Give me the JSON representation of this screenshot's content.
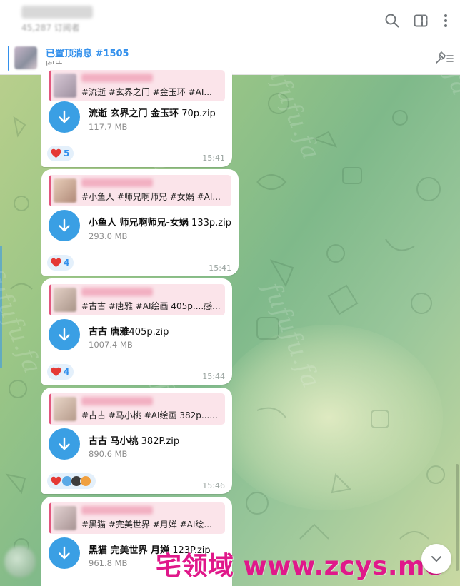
{
  "header": {
    "chat_title": "",
    "chat_subtitle": "45,287 订阅者",
    "icons": [
      "search-icon",
      "sidebar-toggle-icon",
      "more-vert-icon"
    ]
  },
  "pinned": {
    "title": "已置顶消息 #1505",
    "subtitle": "图片"
  },
  "messages": [
    {
      "reply_tags": "#流逝 #玄界之门 #金玉环 #AI...",
      "file_bold": "流逝 玄界之门 金玉环",
      "file_rest": " 70p.zip",
      "size": "117.7 MB",
      "reaction_count": "5",
      "time": "15:41"
    },
    {
      "reply_tags": "#小鱼人 #师兄啊师兄 #女娲 #AI...",
      "file_bold": "小鱼人 师兄啊师兄-女娲",
      "file_rest": " 133p.zip",
      "size": "293.0 MB",
      "reaction_count": "4",
      "time": "15:41"
    },
    {
      "reply_tags": "#古古 #唐雅 #AI绘画 405p....感...",
      "file_bold": "古古 唐雅",
      "file_rest": "405p.zip",
      "size": "1007.4 MB",
      "reaction_count": "4",
      "time": "15:44"
    },
    {
      "reply_tags": "#古古 #马小桃 #AI绘画 382p......",
      "file_bold": "古古 马小桃",
      "file_rest": " 382P.zip",
      "size": "890.6 MB",
      "reaction_count": "",
      "time": "15:46"
    },
    {
      "reply_tags": "#黑猫 #完美世界 #月婵 #AI绘...",
      "file_bold": "黑猫 完美世界 月婵",
      "file_rest": " 123P.zip",
      "size": "961.8 MB",
      "reaction_count": "",
      "time": ""
    }
  ],
  "watermarks": {
    "main": "宅领域 www.zcys.me",
    "diagonal": "fufufu.fa"
  },
  "colors": {
    "accent": "#3390ec",
    "download_button": "#3a9fe4",
    "reply_bar": "#e2567d",
    "reply_bg": "#fbe4ea",
    "heart": "#e53935",
    "watermark": "#e0188a"
  }
}
